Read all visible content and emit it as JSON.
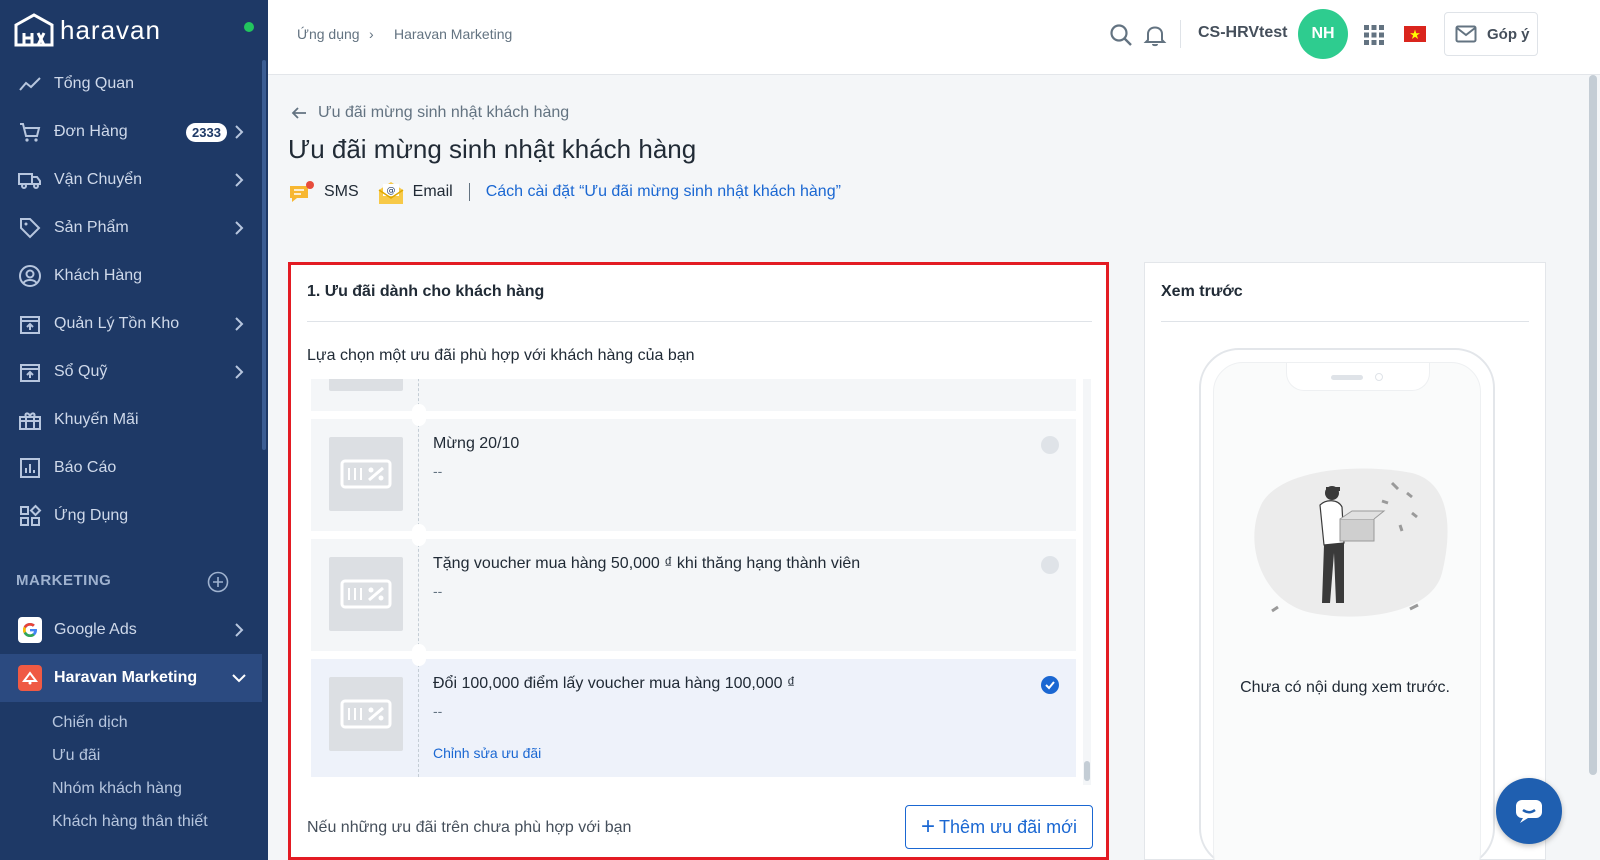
{
  "brand": {
    "name": "haravan"
  },
  "sidebar": {
    "items": [
      {
        "label": "Tổng Quan",
        "icon": "chart-line-icon"
      },
      {
        "label": "Đơn Hàng",
        "icon": "cart-icon",
        "badge": "2333"
      },
      {
        "label": "Vận Chuyển",
        "icon": "truck-icon"
      },
      {
        "label": "Sản Phẩm",
        "icon": "tag-icon"
      },
      {
        "label": "Khách Hàng",
        "icon": "user-circle-icon"
      },
      {
        "label": "Quản Lý Tồn Kho",
        "icon": "inventory-icon"
      },
      {
        "label": "Sổ Quỹ",
        "icon": "cashbook-icon"
      },
      {
        "label": "Khuyến Mãi",
        "icon": "gift-icon"
      },
      {
        "label": "Báo Cáo",
        "icon": "report-icon"
      },
      {
        "label": "Ứng Dụng",
        "icon": "apps-icon"
      }
    ],
    "section_title": "MARKETING",
    "marketing_apps": [
      {
        "label": "Google Ads",
        "icon": "google-icon"
      },
      {
        "label": "Haravan Marketing",
        "icon": "haravan-marketing-icon"
      }
    ],
    "sub_items": [
      "Chiến dịch",
      "Ưu đãi",
      "Nhóm khách hàng",
      "Khách hàng thân thiết"
    ]
  },
  "topbar": {
    "breadcrumb": [
      "Ứng dụng",
      "Haravan Marketing"
    ],
    "store_name": "CS-HRVtest",
    "avatar_initials": "NH",
    "feedback_label": "Góp ý"
  },
  "page": {
    "back_label": "Ưu đãi mừng sinh nhật khách hàng",
    "title": "Ưu đãi mừng sinh nhật khách hàng",
    "channels": [
      "SMS",
      "Email"
    ],
    "guide_link": "Cách cài đặt “Ưu đãi mừng sinh nhật khách hàng”"
  },
  "offers_card": {
    "title": "1. Ưu đãi dành cho khách hàng",
    "subtitle": "Lựa chọn một ưu đãi phù hợp với khách hàng của bạn",
    "offers": [
      {
        "title": "Mừng 20/10",
        "desc": "--",
        "selected": false
      },
      {
        "title": "Tặng voucher mua hàng 50,000 ₫ khi thăng hạng thành viên",
        "desc": "--",
        "selected": false
      },
      {
        "title": "Đổi 100,000 điểm lấy voucher mua hàng 100,000 ₫",
        "desc": "--",
        "selected": true,
        "edit_label": "Chỉnh sửa ưu đãi"
      }
    ],
    "footer_text": "Nếu những ưu đãi trên chưa phù hợp với bạn",
    "add_button": "Thêm ưu đãi mới"
  },
  "preview_card": {
    "title": "Xem trước",
    "empty_text": "Chưa có nội dung xem trước."
  },
  "colors": {
    "sidebar": "#1e3966",
    "accent": "#1a67d2",
    "highlight_border": "#e31b23",
    "avatar": "#2ecc8f"
  }
}
